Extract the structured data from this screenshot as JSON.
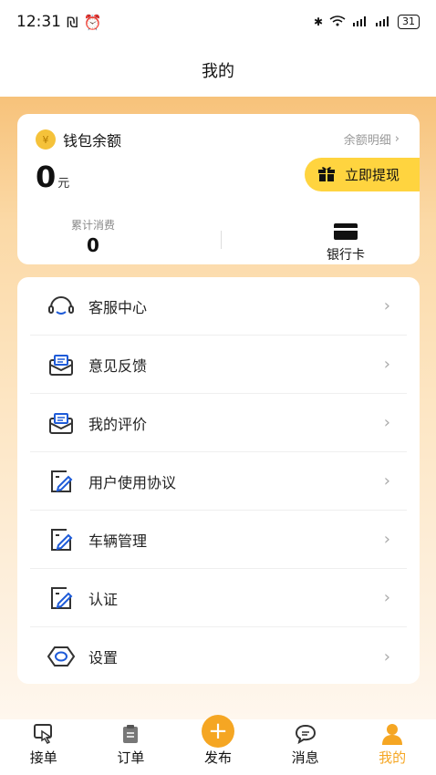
{
  "status_bar": {
    "time": "12:31",
    "battery": "31"
  },
  "header": {
    "title": "我的"
  },
  "wallet": {
    "title": "钱包余额",
    "coin_symbol": "¥",
    "detail_link": "余额明细",
    "balance": "0",
    "unit": "元",
    "withdraw_label": "立即提现",
    "total_spend_label": "累计消费",
    "total_spend_value": "0",
    "bank_card_label": "银行卡"
  },
  "menu": {
    "items": [
      {
        "label": "客服中心",
        "icon": "headset-icon"
      },
      {
        "label": "意见反馈",
        "icon": "feedback-icon"
      },
      {
        "label": "我的评价",
        "icon": "review-icon"
      },
      {
        "label": "用户使用协议",
        "icon": "agreement-icon"
      },
      {
        "label": "车辆管理",
        "icon": "vehicle-icon"
      },
      {
        "label": "认证",
        "icon": "certification-icon"
      },
      {
        "label": "设置",
        "icon": "settings-icon"
      }
    ]
  },
  "tabbar": {
    "tabs": [
      {
        "label": "接单",
        "icon": "take-order-icon"
      },
      {
        "label": "订单",
        "icon": "orders-icon"
      },
      {
        "label": "发布",
        "icon": "plus-icon"
      },
      {
        "label": "消息",
        "icon": "message-icon"
      },
      {
        "label": "我的",
        "icon": "profile-icon"
      }
    ],
    "active_index": 4
  },
  "colors": {
    "accent": "#f5a623",
    "withdraw_bg": "#ffd43f",
    "header_gradient_top": "#f7c27a"
  }
}
